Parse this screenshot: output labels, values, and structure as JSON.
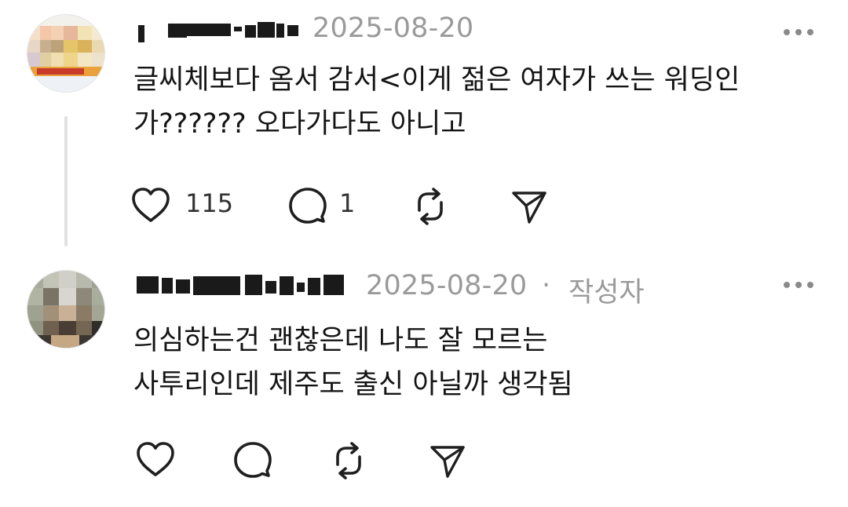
{
  "posts": [
    {
      "timestamp": "2025-08-20",
      "text_lines": [
        "글씨체보다 옴서 감서<이게 젊은 여자가 쓰는 워딩인",
        "가?????? 오다가다도 아니고"
      ],
      "avatar": "pixelated-avatar-icon",
      "actions": {
        "like_count": "115",
        "reply_count": "1"
      }
    },
    {
      "timestamp": "2025-08-20",
      "separator": "·",
      "author_badge": "작성자",
      "text_lines": [
        "의심하는건 괜찮은데 나도 잘 모르는",
        "사투리인데 제주도 출신 아닐까 생각됨"
      ],
      "avatar": "pixelated-avatar-icon",
      "actions": {
        "like_count": "",
        "reply_count": ""
      }
    }
  ],
  "icons": {
    "like": "heart-icon",
    "reply": "comment-icon",
    "repost": "repost-icon",
    "share": "send-icon",
    "more": "more-horizontal-icon"
  },
  "colors": {
    "text": "#141414",
    "muted": "#9a9a9a",
    "icon": "#1f1f1f",
    "thread_line": "#e1e1e1"
  }
}
